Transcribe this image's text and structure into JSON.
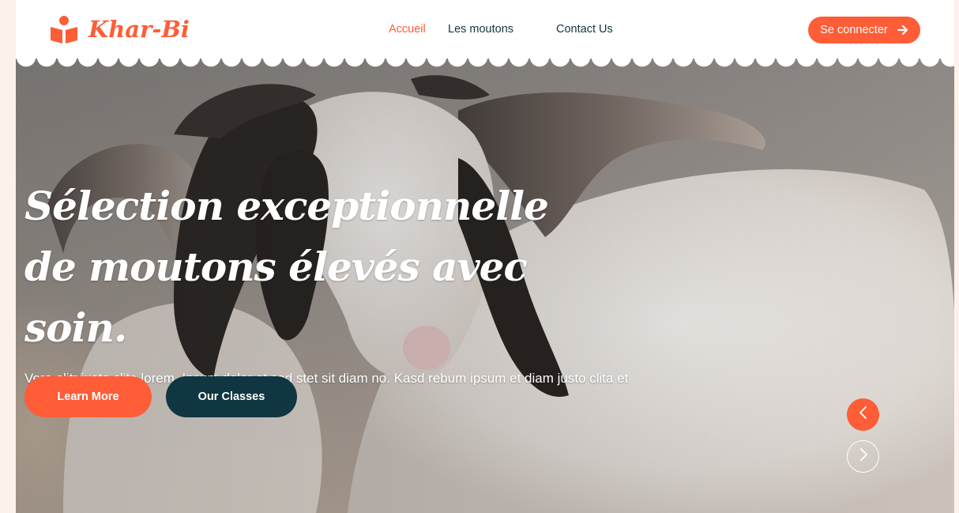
{
  "brand": {
    "name": "Khar-Bi",
    "color": "#fe5d37",
    "icon": "book-reader-icon"
  },
  "nav": {
    "items": [
      {
        "label": "Accueil",
        "active": true
      },
      {
        "label": "Les moutons",
        "active": false
      },
      {
        "label": "Contact Us",
        "active": false
      }
    ],
    "login_label": "Se connecter",
    "login_icon": "arrow-right-icon"
  },
  "hero": {
    "title": "Sélection exceptionnelle de moutons élevés avec soin.",
    "text": "Vero elitr justo clita lorem. Ipsum dolor at sed stet sit diam no. Kasd rebum ipsum et diam justo clita et kasd rebum sea elitr.",
    "primary_button": "Learn More",
    "secondary_button": "Our Classes",
    "image": "sheep-photo",
    "prev_icon": "chevron-left-icon",
    "next_icon": "chevron-right-icon"
  },
  "colors": {
    "accent": "#fe5d37",
    "dark": "#103741",
    "background": "#fdf1ec"
  }
}
